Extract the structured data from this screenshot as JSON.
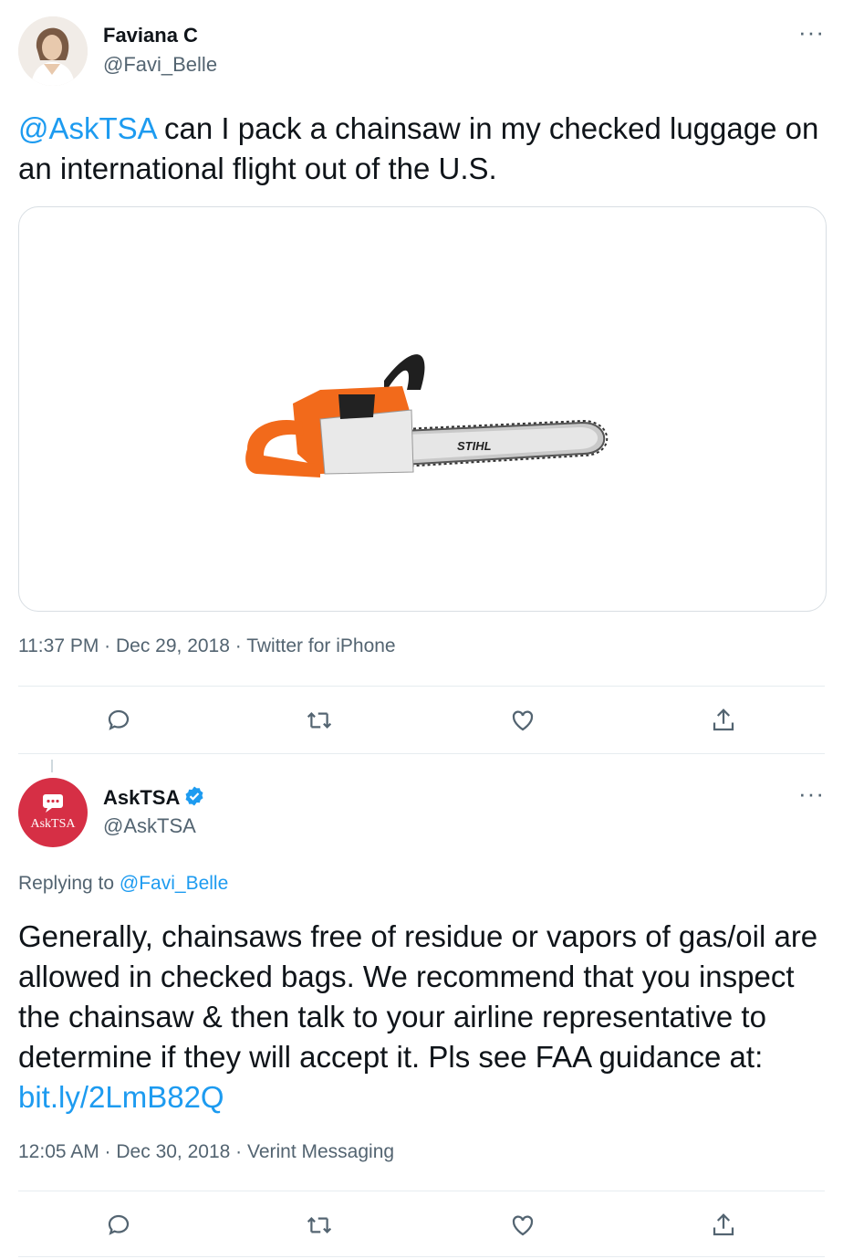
{
  "tweet1": {
    "author_name": "Faviana C",
    "author_handle": "@Favi_Belle",
    "mention": "@AskTSA",
    "text": " can I pack a chainsaw in my checked luggage on an international flight out of the U.S.",
    "image_brand": "STIHL",
    "meta": "11:37 PM · Dec 29, 2018 · Twitter for iPhone"
  },
  "tweet2": {
    "author_name": "AskTSA",
    "author_handle": "@AskTSA",
    "avatar_label": "AskTSA",
    "replying_prefix": "Replying to ",
    "replying_handle": "@Favi_Belle",
    "text": "Generally, chainsaws free of residue or vapors of gas/oil are allowed in checked bags. We recommend that you inspect the chainsaw & then talk to your airline representative to determine if they will accept it. Pls see FAA guidance at: ",
    "link": "bit.ly/2LmB82Q",
    "meta": "12:05 AM · Dec 30, 2018 · Verint Messaging"
  },
  "more_label": "···",
  "icons": [
    "reply-icon",
    "retweet-icon",
    "like-icon",
    "share-icon",
    "verified-badge-icon",
    "more-icon"
  ],
  "colors": {
    "link": "#1d9bf0",
    "muted": "#536471",
    "asktsa_red": "#d62f45",
    "stihl_orange": "#f26a1b"
  }
}
